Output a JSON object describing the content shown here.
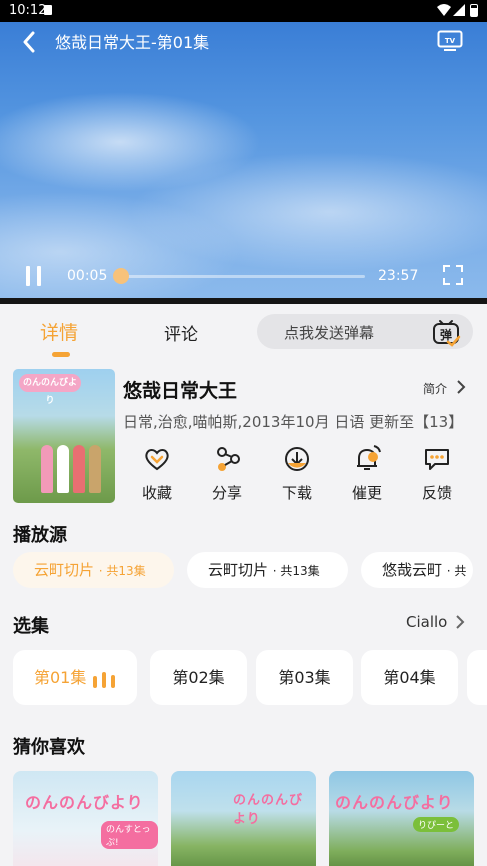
{
  "status_bar": {
    "time": "10:12"
  },
  "player": {
    "title": "悠哉日常大王-第01集",
    "current_time": "00:05",
    "duration": "23:57",
    "progress": 0.0035
  },
  "tabs": {
    "detail": "详情",
    "comments": "评论"
  },
  "danmaku": {
    "placeholder": "点我发送弹幕",
    "icon_text": "弹"
  },
  "show": {
    "title": "悠哉日常大王",
    "intro_label": "简介",
    "meta": "日常,治愈,喵帕斯,2013年10月 日语 更新至【13】"
  },
  "actions": [
    {
      "label": "收藏",
      "icon": "heart-icon"
    },
    {
      "label": "分享",
      "icon": "share-icon"
    },
    {
      "label": "下载",
      "icon": "download-icon"
    },
    {
      "label": "催更",
      "icon": "bell-icon"
    },
    {
      "label": "反馈",
      "icon": "feedback-icon"
    }
  ],
  "sources": {
    "heading": "播放源",
    "items": [
      {
        "name": "云町切片",
        "count": "· 共13集",
        "active": true
      },
      {
        "name": "云町切片",
        "count": "· 共13集",
        "active": false
      },
      {
        "name": "悠哉云町",
        "count": "· 共",
        "active": false
      }
    ]
  },
  "episodes": {
    "heading": "选集",
    "more_label": "Ciallo",
    "items": [
      "第01集",
      "第02集",
      "第03集",
      "第04集"
    ],
    "active_index": 0
  },
  "recommend": {
    "heading": "猜你喜欢",
    "items": [
      {
        "logo": "のんのんびより",
        "sub": "のんすとっぷ!"
      },
      {
        "logo": "のんのんびより",
        "sub": ""
      },
      {
        "logo": "のんのんびより",
        "sub": "りぴーと"
      }
    ]
  },
  "colors": {
    "accent": "#f5a335",
    "background": "#f3f3f5",
    "card": "#ffffff"
  }
}
